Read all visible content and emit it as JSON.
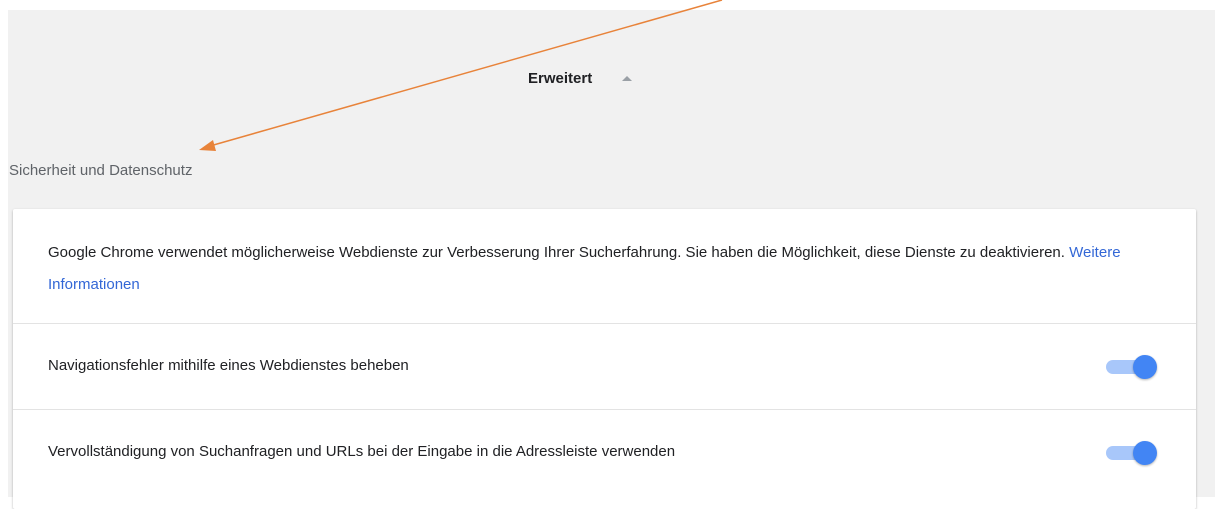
{
  "advanced": {
    "label": "Erweitert"
  },
  "section": {
    "title": "Sicherheit und Datenschutz"
  },
  "card": {
    "description": "Google Chrome verwendet möglicherweise Webdienste zur Verbesserung Ihrer Sucherfahrung. Sie haben die Möglichkeit, diese Dienste zu deaktivieren.",
    "learn_more": "Weitere Informationen"
  },
  "settings": [
    {
      "label": "Navigationsfehler mithilfe eines Webdienstes beheben",
      "enabled": true
    },
    {
      "label": "Vervollständigung von Suchanfragen und URLs bei der Eingabe in die Adressleiste verwenden",
      "enabled": true
    }
  ],
  "colors": {
    "accent": "#4285f4",
    "toggle_track": "#a8c7fa",
    "link": "#3367d6",
    "annotation_arrow": "#e8833a",
    "background": "#f1f1f1"
  },
  "icons": {
    "advanced_caret": "caret-up-icon"
  }
}
